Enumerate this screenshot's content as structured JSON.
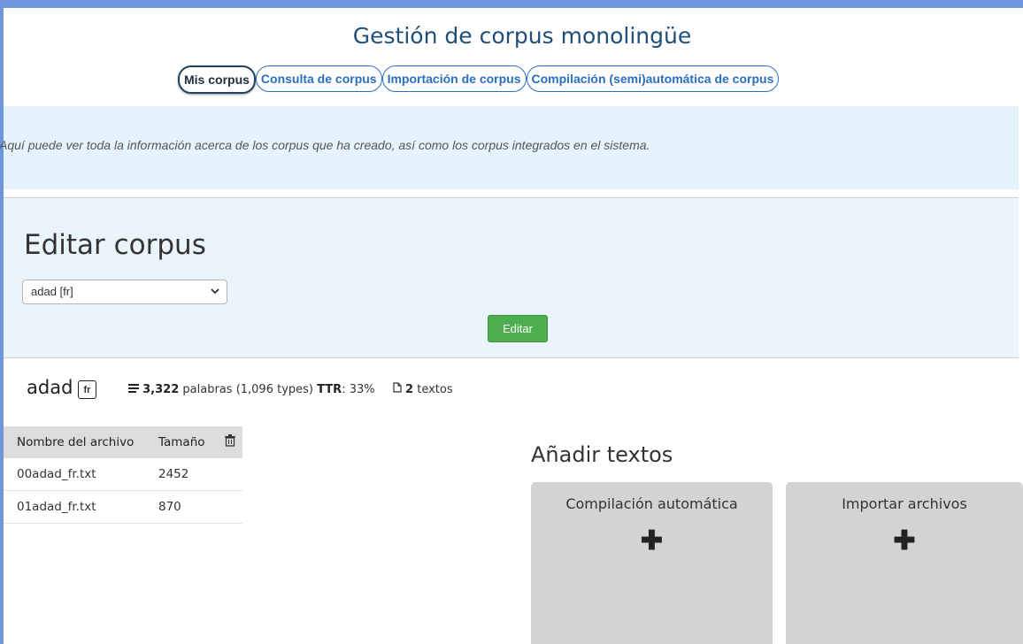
{
  "app": {
    "title": "Gestión de corpus monolingüe"
  },
  "tabs": [
    {
      "label": "Mis corpus",
      "active": true
    },
    {
      "label": "Consulta de corpus",
      "active": false
    },
    {
      "label": "Importación de corpus",
      "active": false
    },
    {
      "label": "Compilación (semi)automática de corpus",
      "active": false
    }
  ],
  "info": {
    "text": "Aquí puede ver toda la información acerca de los corpus que ha creado, así como los corpus integrados en el sistema."
  },
  "edit": {
    "title": "Editar corpus",
    "selected_corpus": "adad [fr]",
    "button_label": "Editar"
  },
  "corpus": {
    "name": "adad",
    "lang": "fr",
    "words": "3,322",
    "words_label": "palabras",
    "types": "(1,096 types)",
    "ttr_label": "TTR",
    "ttr_value": ": 33%",
    "texts": "2",
    "texts_label": "textos"
  },
  "files": {
    "headers": {
      "name": "Nombre del archivo",
      "size": "Tamaño"
    },
    "rows": [
      {
        "name": "00adad_fr.txt",
        "size": "2452"
      },
      {
        "name": "01adad_fr.txt",
        "size": "870"
      }
    ]
  },
  "add_texts": {
    "title": "Añadir textos",
    "cards": [
      {
        "label": "Compilación automática",
        "icon": "plus-icon"
      },
      {
        "label": "Importar archivos",
        "icon": "plus-icon"
      }
    ]
  },
  "colors": {
    "accent": "#2a6fbf",
    "title": "#1f4e79",
    "info_band": "#e5f3fd",
    "edit_band": "#eaf4fb",
    "button_green": "#4cae4c",
    "card_gray": "#d3d3d3",
    "frame": "#6d96dc"
  }
}
